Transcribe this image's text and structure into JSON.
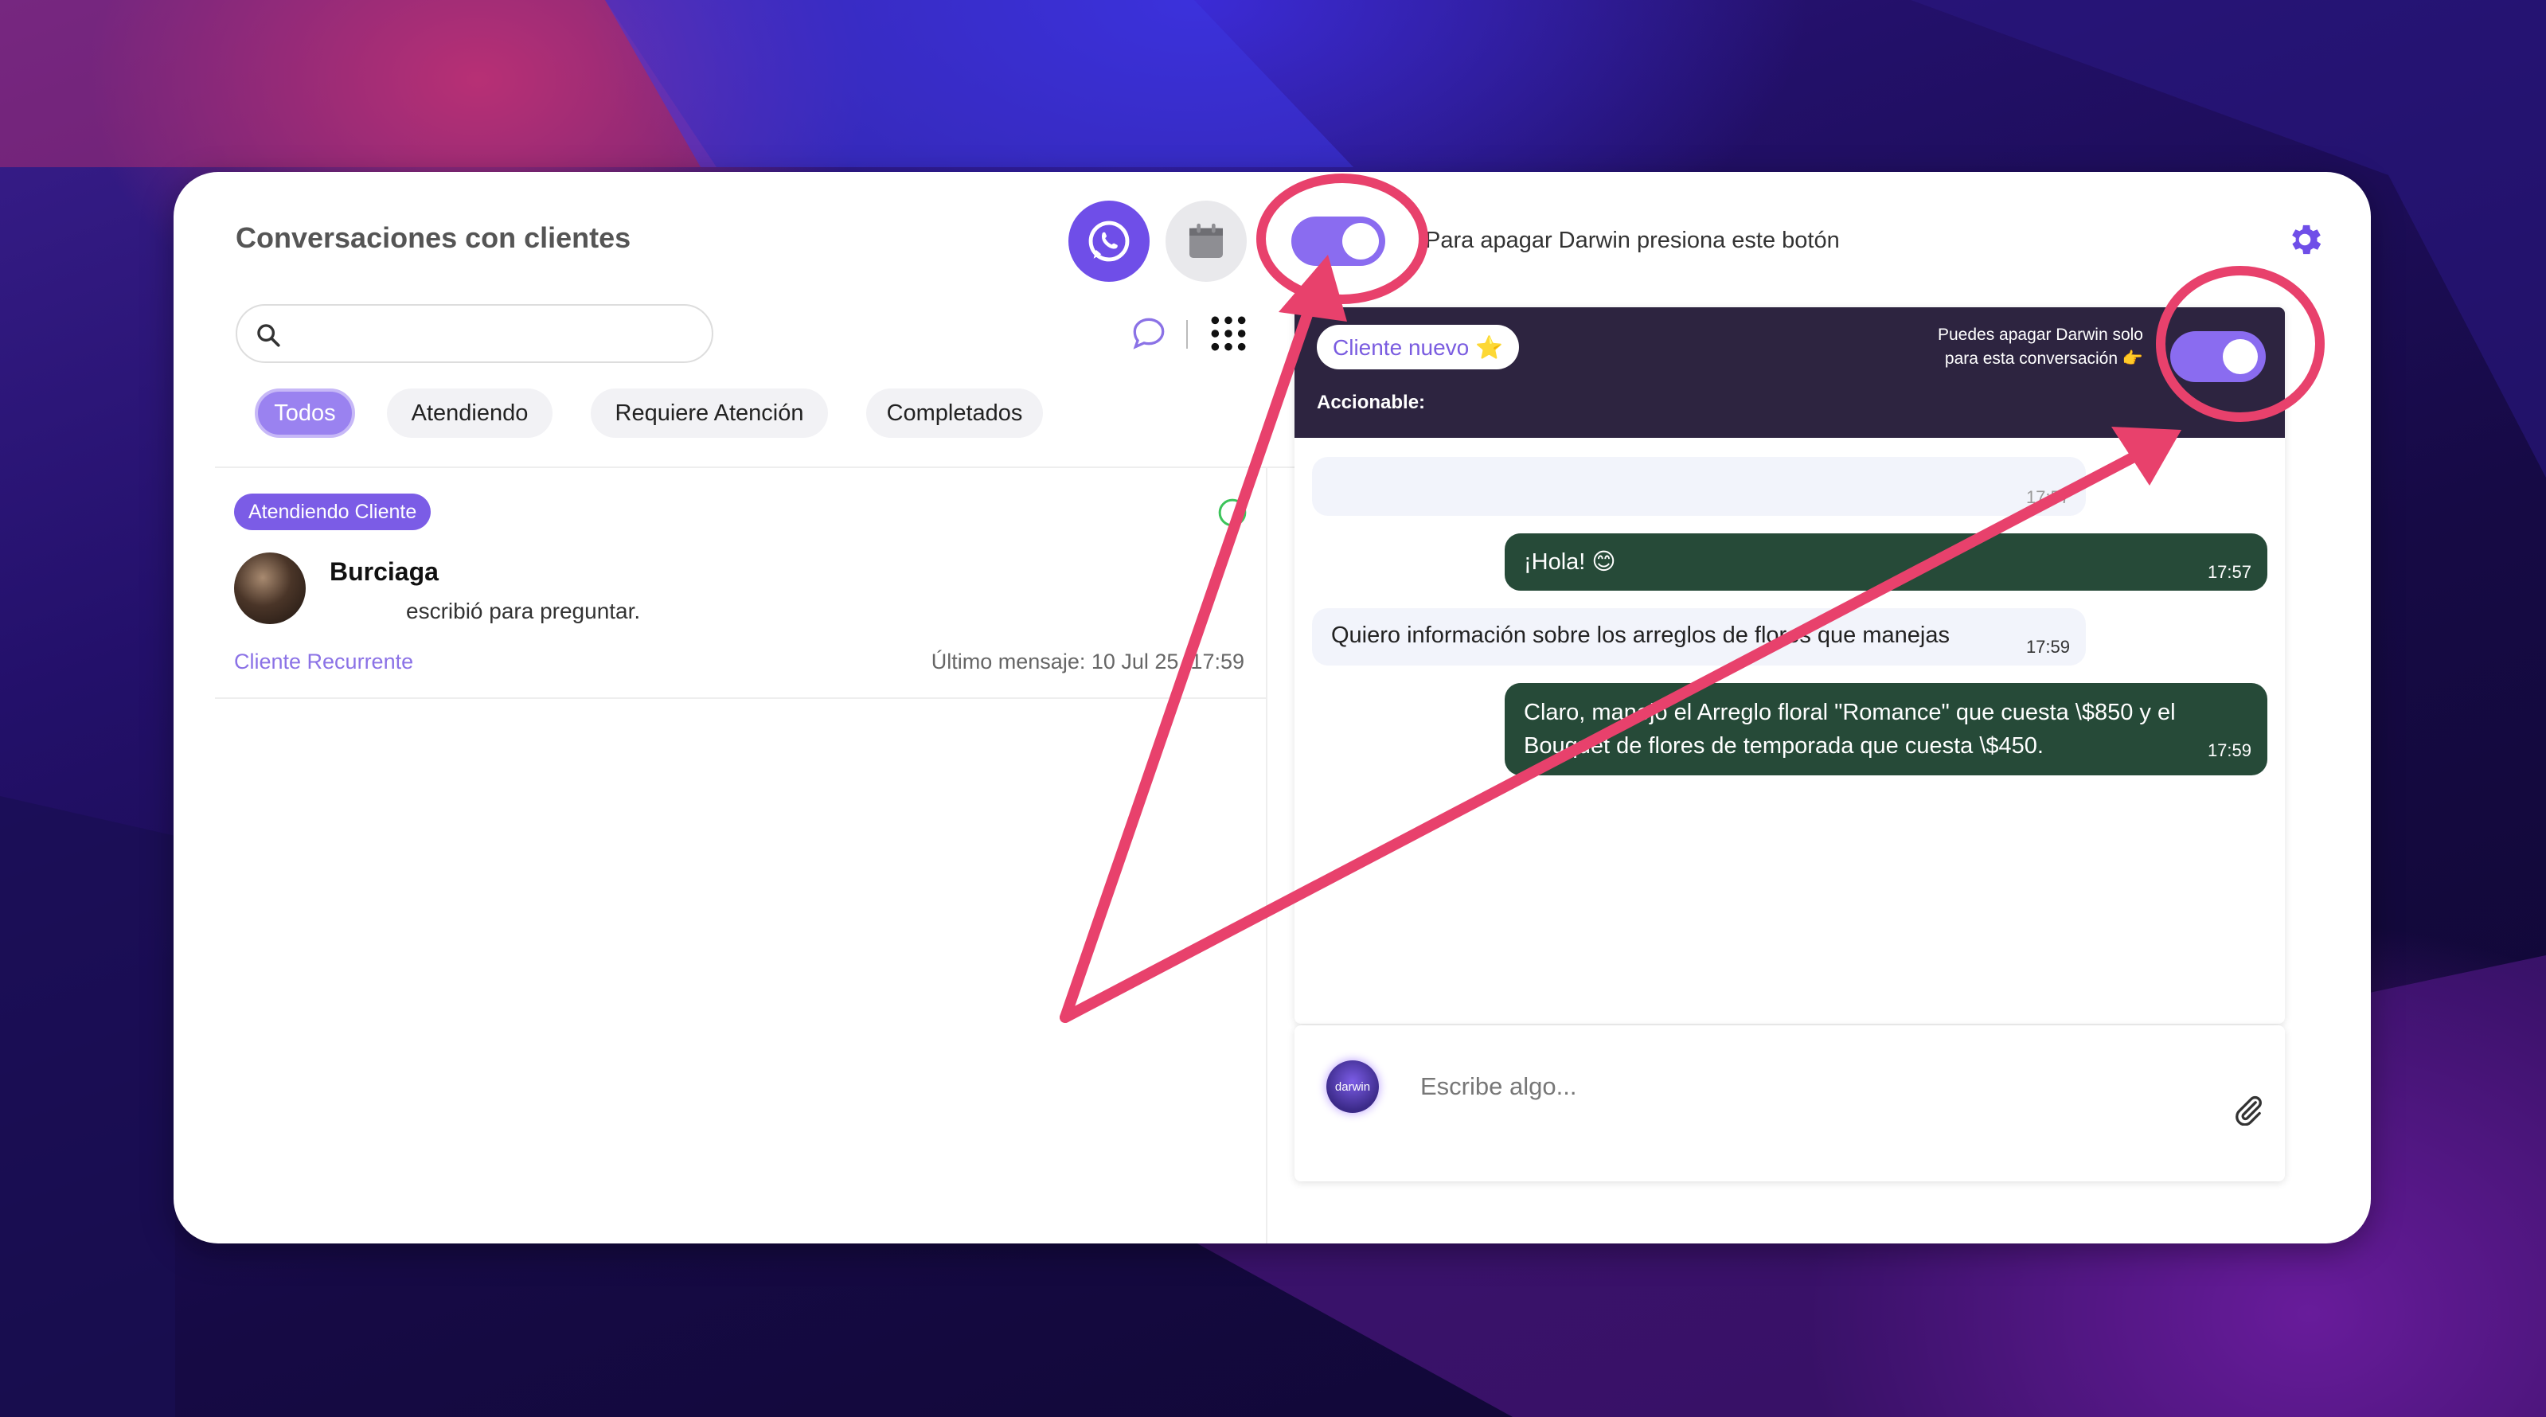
{
  "app": {
    "title": "Conversaciones con clientes",
    "toggle_hint": "Para apagar Darwin presiona este botón"
  },
  "search": {
    "placeholder": ""
  },
  "tabs": [
    {
      "label": "Todos",
      "active": true
    },
    {
      "label": "Atendiendo",
      "active": false
    },
    {
      "label": "Requiere Atención",
      "active": false
    },
    {
      "label": "Completados",
      "active": false
    }
  ],
  "conversation_item": {
    "badge": "Atendiendo Cliente",
    "name": "Burciaga",
    "preview": "escribió para preguntar.",
    "tag": "Cliente Recurrente",
    "last_message": "Último mensaje: 10 Jul 25, 17:59"
  },
  "chat": {
    "client_tag": "Cliente nuevo ⭐",
    "actionable_label": "Accionable:",
    "conversation_toggle_note": "Puedes apagar Darwin solo para esta conversación 👉",
    "messages": [
      {
        "from": "client",
        "text": "",
        "time": "17:57"
      },
      {
        "from": "bot",
        "text": "¡Hola! 😊",
        "time": "17:57"
      },
      {
        "from": "client",
        "text": "Quiero información sobre los arreglos de flores que manejas",
        "time": "17:59"
      },
      {
        "from": "bot",
        "text": "Claro, manejo el Arreglo floral \"Romance\" que cuesta \\$850 y el Bouquet de flores de temporada que cuesta \\$450.",
        "time": "17:59"
      }
    ]
  },
  "composer": {
    "placeholder": "Escribe algo...",
    "logo_text": "darwin"
  },
  "colors": {
    "accent": "#7b5ce6",
    "bot_bubble": "#264a38",
    "client_bubble": "#f2f4fb",
    "annotation": "#e8416c",
    "header_bg": "#2d2440"
  }
}
